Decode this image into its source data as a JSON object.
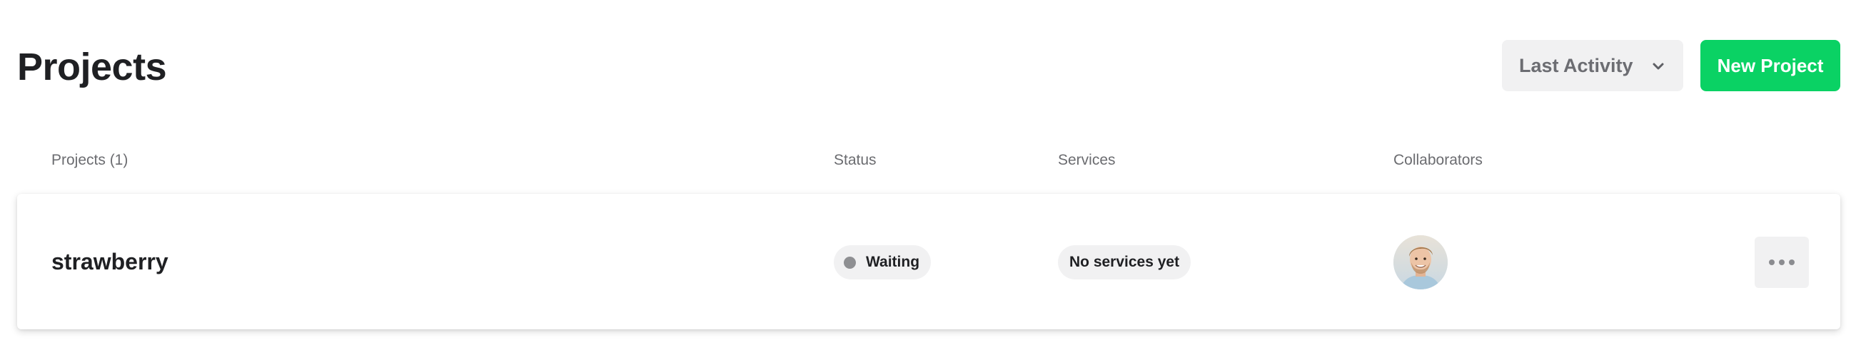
{
  "header": {
    "title": "Projects",
    "sort_label": "Last Activity",
    "new_project_label": "New Project"
  },
  "table": {
    "columns": {
      "projects": "Projects (1)",
      "status": "Status",
      "services": "Services",
      "collaborators": "Collaborators"
    },
    "rows": [
      {
        "name": "strawberry",
        "status": "Waiting",
        "status_dot_color": "#8e8f92",
        "services": "No services yet",
        "collaborator_icon": "avatar"
      }
    ]
  },
  "colors": {
    "accent": "#0ad264",
    "pill_bg": "#f1f1f2",
    "text": "#1f2023",
    "muted": "#6b6c70"
  }
}
